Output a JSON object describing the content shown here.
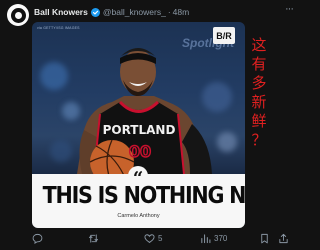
{
  "author": {
    "name": "Ball Knowers",
    "handle": "@ball_knowers_",
    "separator": "·",
    "time": "48m"
  },
  "media": {
    "source_tag": "via GETTY/ISG IMAGES",
    "brand_logo": "B/R",
    "background_text": "Spotlight",
    "jersey_team": "PORTLAND",
    "jersey_number": "00",
    "quote_mark": "“",
    "headline": "THIS IS NOTHING NEW.",
    "attribution": "Carmelo Anthony"
  },
  "overlay_text": [
    "这",
    "有",
    "多",
    "新",
    "鲜",
    "？"
  ],
  "actions": {
    "reply": {
      "icon": "reply-icon",
      "count": ""
    },
    "retweet": {
      "icon": "retweet-icon",
      "count": ""
    },
    "like": {
      "icon": "heart-icon",
      "count": "5"
    },
    "views": {
      "icon": "views-icon",
      "count": "370"
    },
    "bookmark": {
      "icon": "bookmark-icon",
      "count": ""
    },
    "share": {
      "icon": "share-icon",
      "count": ""
    }
  },
  "colors": {
    "background": "#121212",
    "overlay_text": "#e02020",
    "muted": "#8b98a5",
    "verified": "#1d9bf0",
    "jersey": "#111111",
    "jersey_trim": "#c8102e"
  }
}
